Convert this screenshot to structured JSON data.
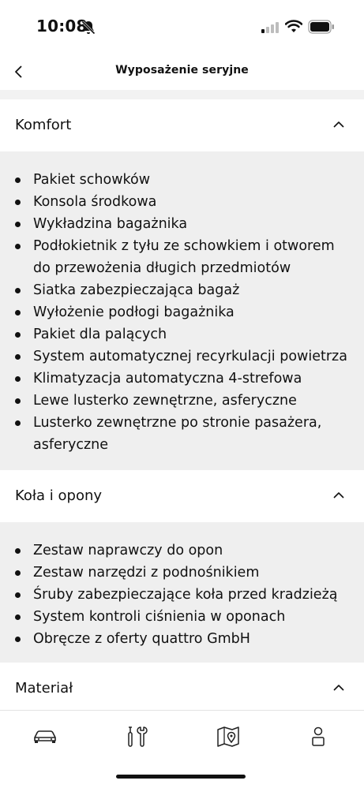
{
  "status": {
    "time": "10:08"
  },
  "nav": {
    "title": "Wyposażenie seryjne"
  },
  "sections": [
    {
      "title": "Komfort",
      "items": [
        "Pakiet schowków",
        "Konsola środkowa",
        "Wykładzina bagażnika",
        "Podłokietnik z tyłu ze schowkiem i otworem do przewożenia długich przedmiotów",
        "Siatka zabezpieczająca bagaż",
        "Wyłożenie podłogi bagażnika",
        "Pakiet dla palących",
        "System automatycznej recyrkulacji powietrza",
        "Klimatyzacja automatyczna 4-strefowa",
        "Lewe lusterko zewnętrzne, asferyczne",
        "Lusterko zewnętrzne po stronie pasażera, asferyczne"
      ]
    },
    {
      "title": "Koła i opony",
      "items": [
        "Zestaw naprawczy do opon",
        "Zestaw narzędzi z podnośnikiem",
        "Śruby zabezpieczające koła przed kradzieżą",
        "System kontroli ciśnienia w oponach",
        "Obręcze z oferty quattro GmbH"
      ]
    },
    {
      "title": "Materiał",
      "items": []
    }
  ],
  "tabs": [
    "car-icon",
    "tools-icon",
    "map-icon",
    "profile-icon"
  ],
  "colors": {
    "panel": "#efefef",
    "divider": "#f2f2f2",
    "text": "#111111"
  }
}
